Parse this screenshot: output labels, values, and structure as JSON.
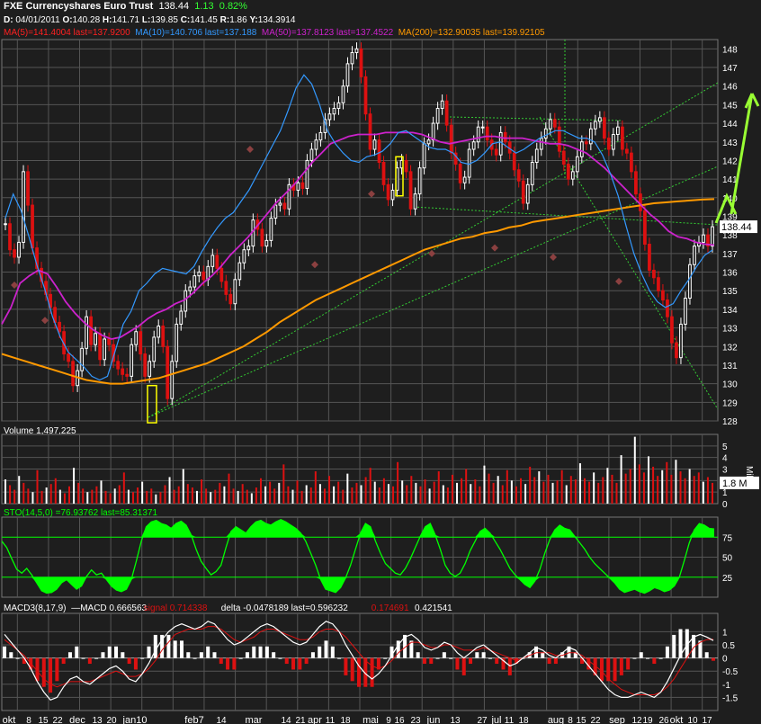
{
  "header": {
    "symbol": "FXE",
    "name": "Currencyshares Euro Trust",
    "last": "138.44",
    "change": "1.13",
    "change_pct": "0.82%",
    "date_label": "D:",
    "date": "04/01/2011",
    "open_label": "O:",
    "open": "140.28",
    "high_label": "H:",
    "high": "141.71",
    "low_label": "L:",
    "low": "139.85",
    "close_label": "C:",
    "close": "141.45",
    "range_label": "R:",
    "range": "1.86",
    "y_label": "Y:",
    "y": "134.3914"
  },
  "legend": {
    "ma5": "MA(5)=141.4004 last=137.9200",
    "ma10": "MA(10)=140.706 last=137.188",
    "ma50": "MA(50)=137.8123 last=137.4522",
    "ma200": "MA(200)=132.90035 last=139.92105",
    "volume": "Volume 1,497,225",
    "volume_last": "1.8 M",
    "volume_unit": "Millio",
    "sto": "STO(14,5,0) =76.93762 last=85.31371",
    "macd_name": "MACD3(8,17,9)",
    "macd_val": "—MACD 0.666563",
    "macd_sig": "signal 0.714338",
    "macd_delta": "delta -0.0478189 last=0.596232",
    "macd_sig_last": "0.174691",
    "macd_last": "0.421541"
  },
  "colors": {
    "ma5": "#ff2020",
    "ma10": "#3399ff",
    "ma50": "#cc22cc",
    "ma200": "#ff9900",
    "up": "#ffffff",
    "down": "#dd1111",
    "sto": "#00ff00",
    "highlight": "#ffff00",
    "annotation_arrow": "#99ff33"
  },
  "chart_data": [
    {
      "type": "candlestick",
      "panel": "price",
      "ylim": [
        128,
        148.5
      ],
      "yticks": [
        128,
        129,
        130,
        131,
        132,
        133,
        134,
        135,
        136,
        137,
        138,
        139,
        140,
        141,
        142,
        143,
        144,
        145,
        146,
        147,
        148
      ],
      "last_price_label": "138.44",
      "x_labels": [
        "okt",
        "8",
        "15",
        "22",
        "dec",
        "13",
        "20",
        "jan10",
        "feb7",
        "14",
        "mar",
        "14",
        "21",
        "apr",
        "11",
        "18",
        "mai",
        "9",
        "16",
        "23",
        "jun",
        "13",
        "27",
        "jul",
        "11",
        "18",
        "aug",
        "8",
        "15",
        "22",
        "sep",
        "12",
        "19",
        "26",
        "okt",
        "10",
        "17"
      ],
      "series": [
        {
          "name": "Close",
          "values": [
            138.6,
            137.2,
            136.8,
            137.6,
            141.4,
            139.6,
            137.3,
            136.2,
            135.5,
            134.8,
            134.1,
            133.3,
            132.8,
            131.6,
            131.2,
            129.9,
            130.7,
            131.9,
            133.6,
            132.1,
            132.7,
            131.3,
            132.4,
            132.1,
            131.2,
            130.8,
            130.5,
            130.4,
            132.1,
            132.8,
            131.6,
            130.4,
            131.2,
            132.5,
            133.1,
            132.0,
            129.2,
            131.2,
            133.2,
            133.9,
            135.0,
            135.2,
            135.8,
            136.0,
            135.6,
            136.3,
            136.9,
            136.2,
            135.5,
            134.8,
            134.3,
            135.6,
            136.5,
            137.2,
            137.4,
            138.8,
            138.3,
            137.4,
            137.7,
            138.9,
            139.6,
            139.7,
            139.4,
            140.7,
            140.4,
            140.8,
            140.5,
            142.0,
            142.6,
            143.1,
            143.5,
            144.2,
            144.5,
            144.8,
            145.1,
            146.0,
            147.2,
            147.8,
            148.0,
            146.5,
            144.5,
            142.6,
            143.1,
            141.9,
            140.7,
            139.9,
            140.4,
            141.6,
            142.0,
            141.4,
            139.4,
            140.2,
            141.6,
            142.9,
            143.1,
            144.0,
            144.8,
            145.2,
            143.9,
            142.4,
            141.8,
            140.8,
            141.1,
            142.6,
            143.0,
            143.8,
            143.8,
            143.1,
            142.6,
            142.3,
            143.5,
            143.0,
            142.4,
            141.5,
            140.9,
            139.7,
            140.7,
            141.9,
            142.6,
            143.2,
            143.7,
            144.2,
            143.8,
            142.5,
            141.8,
            141.0,
            141.4,
            142.2,
            143.0,
            142.9,
            143.7,
            144.1,
            144.3,
            143.2,
            142.6,
            143.4,
            143.8,
            142.6,
            142.4,
            141.4,
            140.2,
            139.3,
            137.5,
            136.1,
            135.7,
            135.0,
            134.5,
            133.6,
            132.2,
            131.4,
            133.2,
            134.6,
            136.4,
            137.4,
            137.6,
            138.0,
            137.4,
            138.44
          ]
        },
        {
          "name": "MA(10)",
          "values": [
            138.9,
            140.2,
            139.3,
            137.9,
            136.4,
            135.1,
            133.6,
            132.5,
            131.7,
            131.3,
            130.9,
            130.4,
            130.2,
            130.4,
            131.8,
            133.2,
            133.9,
            135.0,
            135.4,
            135.9,
            136.2,
            136.1,
            136.0,
            135.9,
            136.3,
            137.1,
            137.8,
            138.4,
            138.9,
            139.2,
            139.8,
            140.4,
            141.2,
            142.0,
            142.8,
            143.6,
            144.7,
            145.9,
            146.6,
            146.1,
            145.0,
            143.6,
            142.9,
            142.4,
            142.0,
            141.9,
            142.2,
            142.3,
            142.5,
            142.9,
            143.5,
            143.6,
            143.3,
            143.0,
            142.7,
            142.6,
            142.6,
            142.4,
            141.9,
            141.8,
            142.0,
            142.4,
            142.9,
            143.0,
            142.7,
            142.4,
            142.6,
            142.9,
            143.2,
            143.4,
            143.6,
            143.6,
            143.4,
            143.2,
            143.2,
            143.0,
            142.3,
            141.3,
            140.1,
            138.5,
            137.0,
            135.9,
            135.0,
            134.4,
            134.1,
            134.3,
            135.0,
            135.6,
            136.3,
            136.9,
            137.188
          ]
        },
        {
          "name": "MA(50)",
          "values": [
            133.2,
            134.1,
            135.4,
            135.8,
            136.1,
            135.9,
            135.2,
            134.4,
            133.8,
            133.3,
            132.9,
            132.6,
            132.4,
            132.5,
            132.8,
            133.1,
            133.5,
            133.8,
            134.0,
            134.3,
            134.5,
            134.9,
            135.4,
            135.8,
            136.3,
            136.9,
            137.4,
            137.9,
            138.5,
            139.1,
            139.7,
            140.2,
            140.7,
            141.3,
            141.9,
            142.4,
            142.9,
            143.1,
            143.3,
            143.4,
            143.4,
            143.4,
            143.5,
            143.5,
            143.5,
            143.5,
            143.4,
            143.2,
            143.0,
            142.9,
            143.0,
            143.1,
            143.2,
            143.3,
            143.3,
            143.2,
            143.2,
            143.2,
            143.1,
            143.0,
            142.9,
            142.9,
            142.8,
            142.6,
            142.4,
            142.0,
            141.6,
            141.1,
            140.6,
            140.1,
            139.6,
            139.1,
            138.7,
            138.2,
            137.9,
            137.8,
            137.6,
            137.5,
            137.4522
          ]
        },
        {
          "name": "MA(200)",
          "values": [
            131.6,
            131.4,
            131.2,
            131.0,
            130.8,
            130.6,
            130.4,
            130.2,
            130.1,
            130.0,
            130.0,
            130.1,
            130.2,
            130.3,
            130.5,
            130.7,
            130.9,
            131.1,
            131.4,
            131.7,
            132.0,
            132.4,
            132.8,
            133.3,
            133.7,
            134.1,
            134.5,
            134.8,
            135.1,
            135.4,
            135.7,
            136.0,
            136.3,
            136.6,
            136.9,
            137.2,
            137.4,
            137.6,
            137.8,
            137.9,
            138.1,
            138.2,
            138.4,
            138.5,
            138.7,
            138.8,
            138.9,
            139.0,
            139.1,
            139.2,
            139.3,
            139.4,
            139.5,
            139.6,
            139.7,
            139.75,
            139.8,
            139.85,
            139.9,
            139.92105
          ]
        }
      ]
    },
    {
      "type": "bar",
      "panel": "volume",
      "ylabel": "Millio",
      "ylim": [
        0,
        6
      ],
      "yticks": [
        0,
        1,
        2,
        3,
        4,
        5
      ],
      "values": [
        2.1,
        1.6,
        1.2,
        2.4,
        1.8,
        1.3,
        1.0,
        2.9,
        1.1,
        1.4,
        1.7,
        2.2,
        1.2,
        0.9,
        1.5,
        3.1,
        1.8,
        1.3,
        1.0,
        1.2,
        1.5,
        2.0,
        1.1,
        0.9,
        1.3,
        1.6,
        2.7,
        1.2,
        1.0,
        1.4,
        1.9,
        1.1,
        1.3,
        0.8,
        1.0,
        1.6,
        2.3,
        1.2,
        1.5,
        3.0,
        1.7,
        1.4,
        1.1,
        2.1,
        1.3,
        1.0,
        1.2,
        1.8,
        1.5,
        2.6,
        1.3,
        1.1,
        1.7,
        1.2,
        0.9,
        1.4,
        2.2,
        1.5,
        1.9,
        1.3,
        1.8,
        3.4,
        1.5,
        1.2,
        2.0,
        1.1,
        1.6,
        1.4,
        2.8,
        1.7,
        1.3,
        2.4,
        1.5,
        1.9,
        1.2,
        2.6,
        1.4,
        1.8,
        1.6,
        2.3,
        3.1,
        1.9,
        1.4,
        2.2,
        1.7,
        1.5,
        3.6,
        2.0,
        1.6,
        2.4,
        1.8,
        1.5,
        2.1,
        1.3,
        1.9,
        2.8,
        1.6,
        1.4,
        2.5,
        1.8,
        2.2,
        3.0,
        1.7,
        2.1,
        1.5,
        3.3,
        2.6,
        1.8,
        2.4,
        1.6,
        2.9,
        2.0,
        1.5,
        2.2,
        1.7,
        3.2,
        2.3,
        2.8,
        1.9,
        2.5,
        1.8,
        2.0,
        2.9,
        1.6,
        2.4,
        2.1,
        3.5,
        2.2,
        1.9,
        2.7,
        1.8,
        2.3,
        3.1,
        2.5,
        1.8,
        4.2,
        2.6,
        3.0,
        5.8,
        3.4,
        2.7,
        4.1,
        3.2,
        2.4,
        2.9,
        3.6,
        2.5,
        3.8,
        2.8,
        2.2,
        3.0,
        2.4,
        2.7,
        1.9,
        2.3,
        1.8
      ]
    },
    {
      "type": "line",
      "panel": "stochastic",
      "ylim": [
        0,
        100
      ],
      "yticks": [
        25,
        50,
        75
      ],
      "series": [
        {
          "name": "STO(14,5,0)",
          "values": [
            70,
            62,
            48,
            35,
            30,
            36,
            28,
            18,
            8,
            5,
            6,
            10,
            18,
            22,
            16,
            10,
            14,
            26,
            34,
            28,
            30,
            22,
            14,
            9,
            7,
            10,
            22,
            45,
            70,
            88,
            94,
            96,
            92,
            90,
            86,
            92,
            95,
            90,
            78,
            60,
            45,
            36,
            28,
            32,
            40,
            62,
            82,
            88,
            84,
            80,
            88,
            94,
            96,
            92,
            90,
            94,
            97,
            94,
            90,
            86,
            80,
            70,
            55,
            40,
            22,
            10,
            8,
            6,
            12,
            24,
            40,
            60,
            80,
            92,
            88,
            70,
            55,
            42,
            36,
            30,
            28,
            36,
            48,
            62,
            76,
            88,
            92,
            78,
            60,
            40,
            30,
            26,
            30,
            42,
            58,
            70,
            82,
            86,
            80,
            70,
            60,
            48,
            36,
            28,
            22,
            16,
            12,
            20,
            35,
            55,
            72,
            84,
            90,
            86,
            84,
            76,
            68,
            60,
            50,
            42,
            36,
            30,
            24,
            18,
            10,
            6,
            8,
            10,
            7,
            5,
            8,
            12,
            10,
            7,
            9,
            14,
            25,
            46,
            68,
            84,
            92,
            90,
            86,
            85.31371
          ]
        }
      ]
    },
    {
      "type": "bar",
      "panel": "macd",
      "ylim": [
        -2,
        1.7
      ],
      "yticks": [
        -1.5,
        -1,
        -0.5,
        0,
        0.5,
        1
      ],
      "series": [
        {
          "name": "MACD",
          "values": [
            0.9,
            0.6,
            0.3,
            0.0,
            -0.4,
            -0.9,
            -1.3,
            -1.6,
            -1.5,
            -1.1,
            -0.8,
            -0.7,
            -0.9,
            -1.0,
            -0.8,
            -0.6,
            -0.4,
            -0.3,
            -0.5,
            -0.8,
            -0.9,
            -0.6,
            -0.2,
            0.3,
            0.7,
            1.0,
            1.2,
            1.3,
            1.2,
            1.1,
            1.2,
            1.4,
            1.3,
            1.0,
            0.7,
            0.5,
            0.6,
            0.8,
            1.0,
            1.2,
            1.3,
            1.2,
            1.0,
            0.8,
            0.6,
            0.5,
            0.6,
            0.9,
            1.2,
            1.4,
            1.3,
            1.0,
            0.5,
            0.1,
            -0.3,
            -0.6,
            -0.8,
            -0.6,
            -0.3,
            0.1,
            0.5,
            0.8,
            0.9,
            0.7,
            0.4,
            0.3,
            0.4,
            0.6,
            0.5,
            0.2,
            0.0,
            0.2,
            0.4,
            0.5,
            0.3,
            0.1,
            -0.1,
            -0.3,
            -0.2,
            0.0,
            0.2,
            0.4,
            0.3,
            0.1,
            0.0,
            0.2,
            0.4,
            0.3,
            0.0,
            -0.3,
            -0.6,
            -0.9,
            -1.2,
            -1.4,
            -1.5,
            -1.5,
            -1.4,
            -1.3,
            -1.4,
            -1.5,
            -1.3,
            -0.9,
            -0.4,
            0.1,
            0.5,
            0.8,
            0.9,
            0.8,
            0.666563
          ]
        },
        {
          "name": "signal",
          "values": [
            0.7,
            0.5,
            0.3,
            0.1,
            -0.2,
            -0.5,
            -0.8,
            -1.0,
            -1.1,
            -1.0,
            -0.9,
            -0.9,
            -0.9,
            -0.9,
            -0.8,
            -0.7,
            -0.6,
            -0.5,
            -0.6,
            -0.7,
            -0.7,
            -0.6,
            -0.4,
            -0.1,
            0.3,
            0.6,
            0.9,
            1.0,
            1.1,
            1.1,
            1.1,
            1.2,
            1.2,
            1.1,
            0.9,
            0.7,
            0.6,
            0.7,
            0.8,
            1.0,
            1.1,
            1.1,
            1.0,
            0.9,
            0.8,
            0.7,
            0.7,
            0.8,
            1.0,
            1.1,
            1.1,
            1.0,
            0.8,
            0.5,
            0.2,
            -0.1,
            -0.3,
            -0.4,
            -0.3,
            -0.1,
            0.2,
            0.4,
            0.6,
            0.6,
            0.5,
            0.4,
            0.4,
            0.5,
            0.5,
            0.4,
            0.3,
            0.3,
            0.3,
            0.4,
            0.3,
            0.2,
            0.1,
            0.0,
            -0.1,
            0.0,
            0.1,
            0.2,
            0.2,
            0.2,
            0.1,
            0.1,
            0.2,
            0.2,
            0.1,
            -0.1,
            -0.3,
            -0.5,
            -0.8,
            -1.0,
            -1.2,
            -1.3,
            -1.4,
            -1.4,
            -1.4,
            -1.4,
            -1.3,
            -1.1,
            -0.8,
            -0.4,
            0.0,
            0.4,
            0.6,
            0.7,
            0.714338
          ]
        }
      ]
    }
  ]
}
